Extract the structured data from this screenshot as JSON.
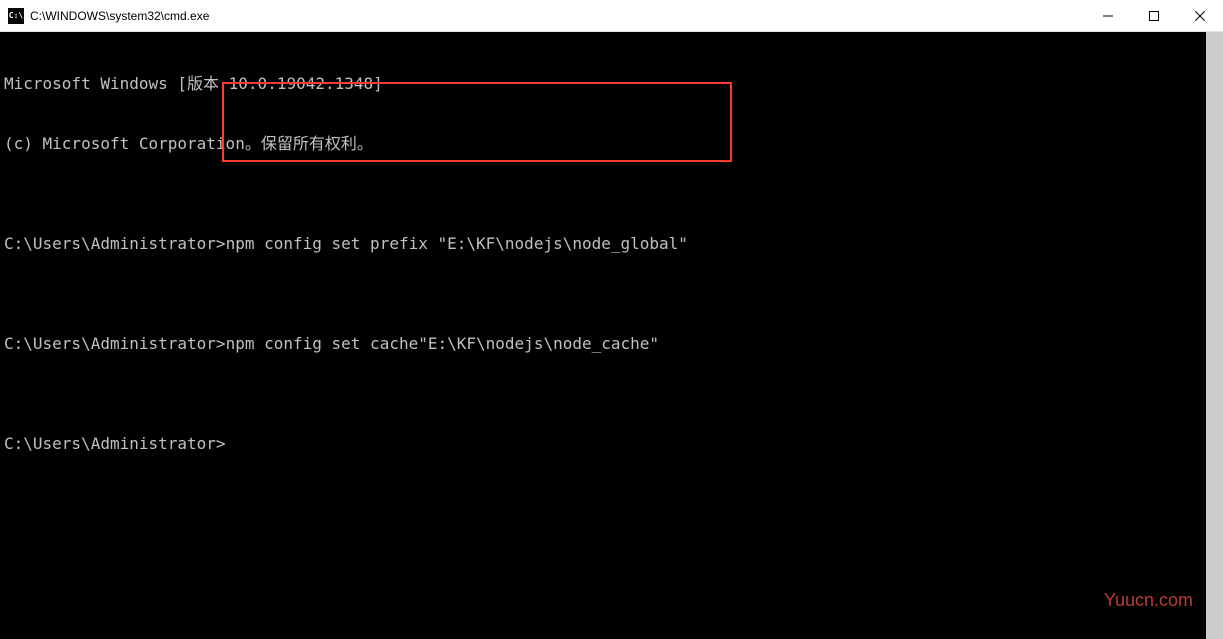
{
  "titlebar": {
    "icon_label": "C:\\",
    "title": "C:\\WINDOWS\\system32\\cmd.exe"
  },
  "terminal": {
    "line1": "Microsoft Windows [版本 10.0.19042.1348]",
    "line2": "(c) Microsoft Corporation。保留所有权利。",
    "blank": "",
    "prompt1": "C:\\Users\\Administrator>",
    "cmd1": "npm config set prefix \"E:\\KF\\nodejs\\node_global\"",
    "prompt2": "C:\\Users\\Administrator>",
    "cmd2": "npm config set cache\"E:\\KF\\nodejs\\node_cache\"",
    "prompt3": "C:\\Users\\Administrator>"
  },
  "watermark": "Yuucn.com"
}
